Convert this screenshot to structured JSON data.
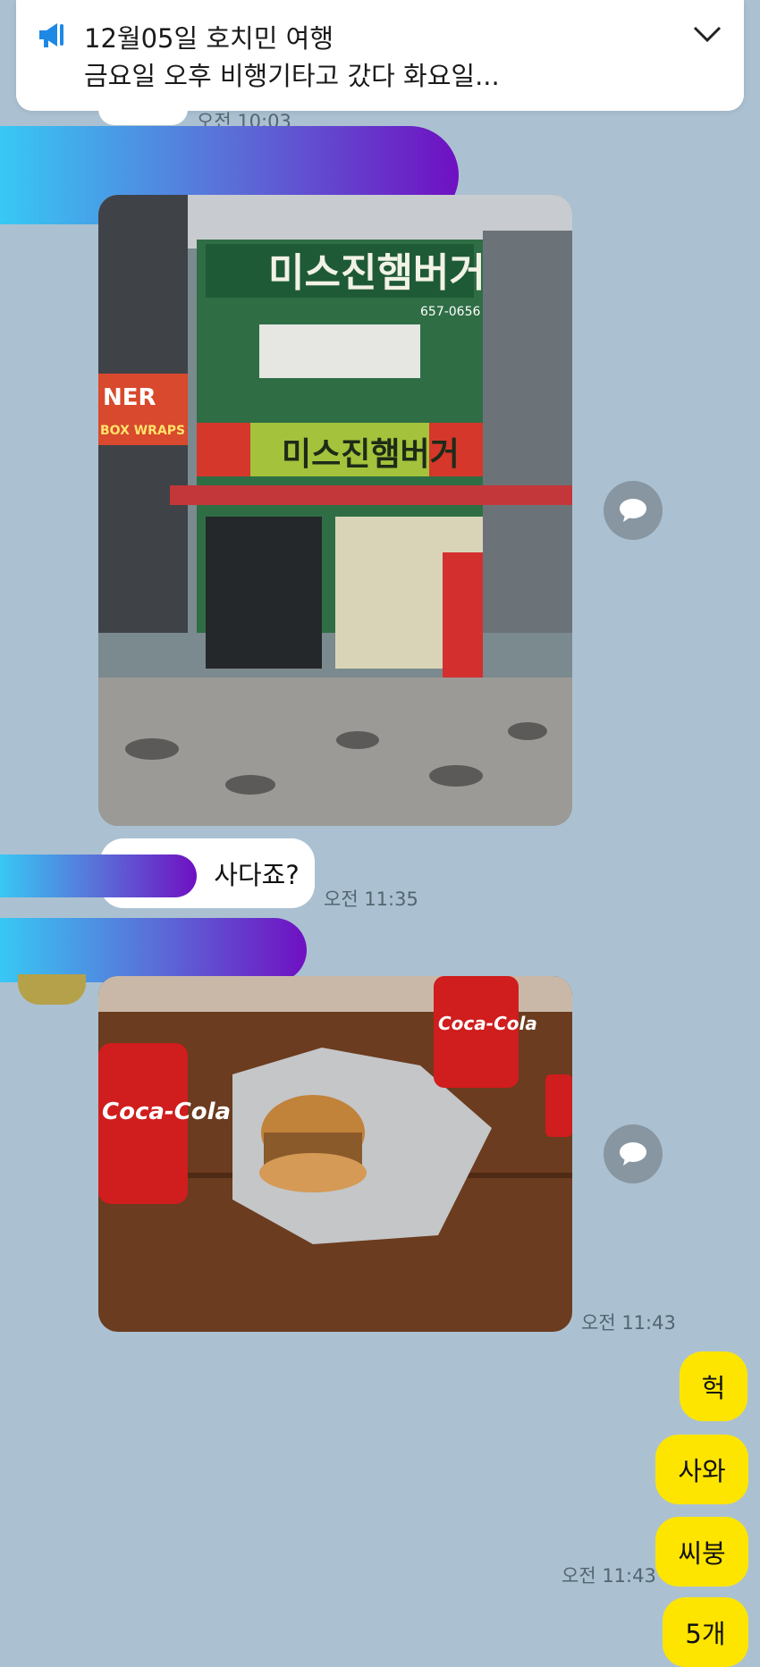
{
  "notice": {
    "title": "12월05일 호치민 여행",
    "preview": "금요일  오후 비행기타고 갔다 화요일...",
    "icon": "megaphone-icon",
    "expand_icon": "chevron-down-icon"
  },
  "messages": {
    "first_time": "오전 10:03",
    "question_text": "사다죠?",
    "question_time": "오전 11:35",
    "burger_photo_time": "오전 11:43",
    "replies": [
      "헉",
      "사와",
      "씨붕",
      "5개"
    ],
    "replies_time": "오전 11:43"
  },
  "photos": {
    "storefront_sign": "미스진햄버거",
    "storefront_phone": "657-0656",
    "neighbor_sign": "NER",
    "neighbor_sub": "BOX WRAPS",
    "can_brand": "Coca-Cola"
  },
  "colors": {
    "chat_background": "#abc1d1",
    "my_bubble": "#fee500",
    "their_bubble": "#ffffff",
    "accent_blue": "#1e88e5"
  }
}
